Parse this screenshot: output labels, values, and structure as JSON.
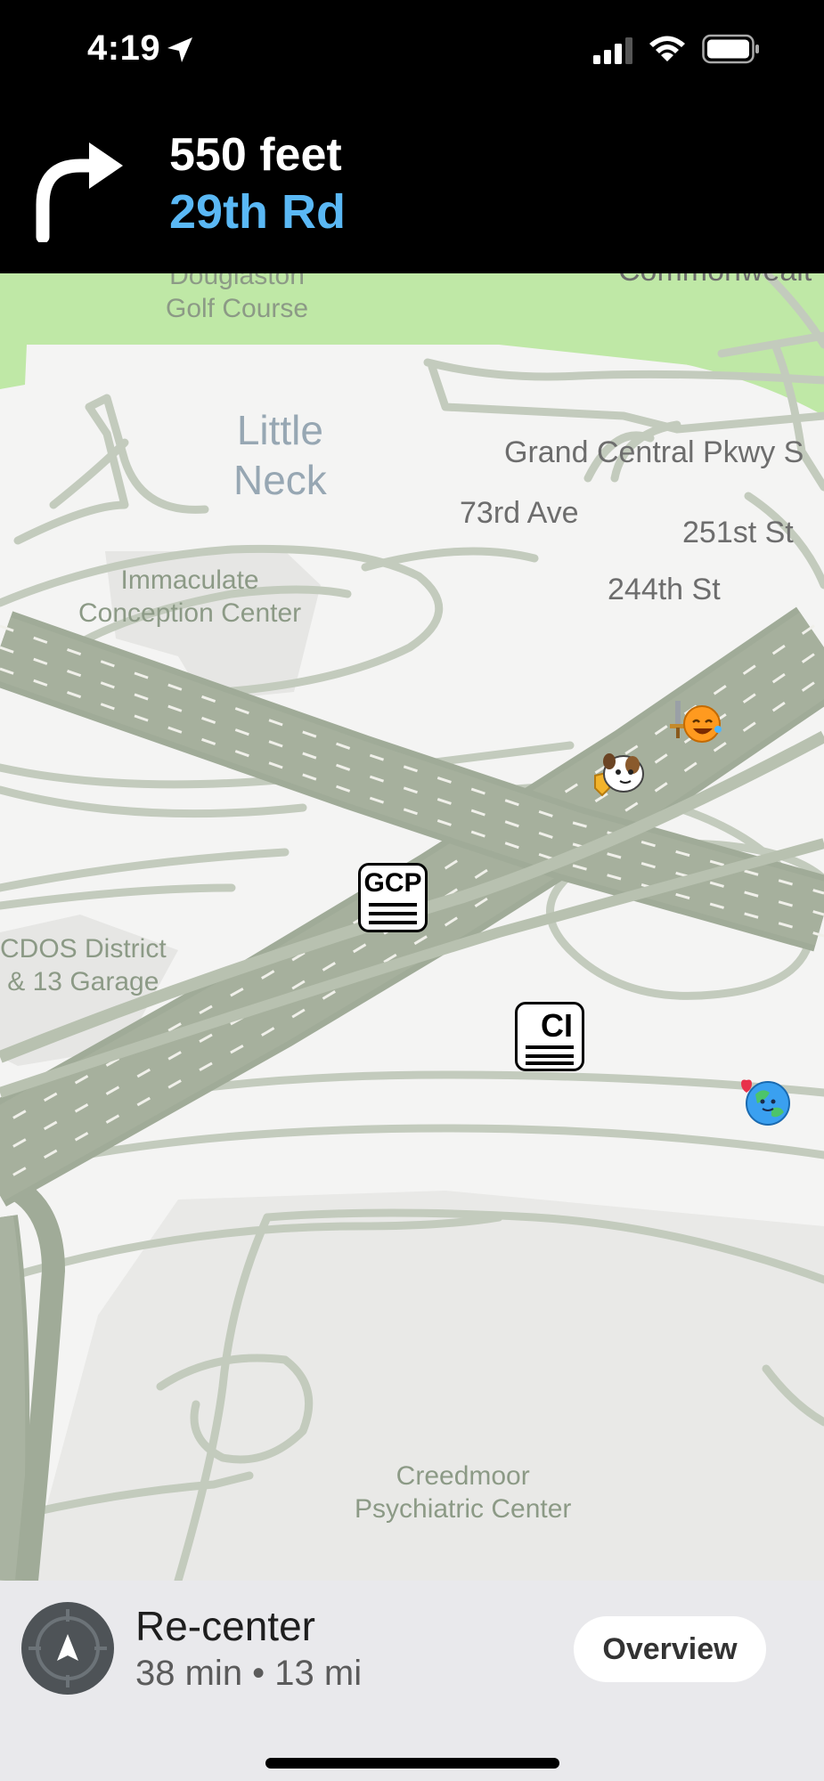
{
  "status_bar": {
    "time": "4:19",
    "icons": [
      "location-arrow-icon",
      "cellular-signal-icon",
      "wifi-icon",
      "battery-icon"
    ]
  },
  "navigation": {
    "maneuver_icon": "turn-right-arrow-icon",
    "distance": "550 feet",
    "street": "29th Rd"
  },
  "map": {
    "place_labels": {
      "golf_course": "Douglaston\nGolf Course",
      "commonwealth": "Commonwealt",
      "neighborhood": "Little\nNeck",
      "immaculate": "Immaculate\nConception Center",
      "dcdos": "CDOS District\n& 13 Garage",
      "creedmoor": "Creedmoor\nPsychiatric Center"
    },
    "road_labels": {
      "grand_central": "Grand Central Pkwy S",
      "ave_73rd": "73rd Ave",
      "st_251st": "251st St",
      "st_244th": "244th St"
    },
    "shields": {
      "gcp": "GCP",
      "ci": "CI"
    },
    "wazers": [
      "knight-wazer-icon",
      "puppy-wazer-icon",
      "earth-heart-wazer-icon"
    ],
    "colors": {
      "park": "#bfe8a6",
      "highway": "#a0ab98",
      "road_outline": "#c3cbbd",
      "background": "#f4f4f3"
    }
  },
  "bottom_bar": {
    "recenter_label": "Re-center",
    "trip_info": "38 min • 13 mi",
    "overview_label": "Overview"
  }
}
